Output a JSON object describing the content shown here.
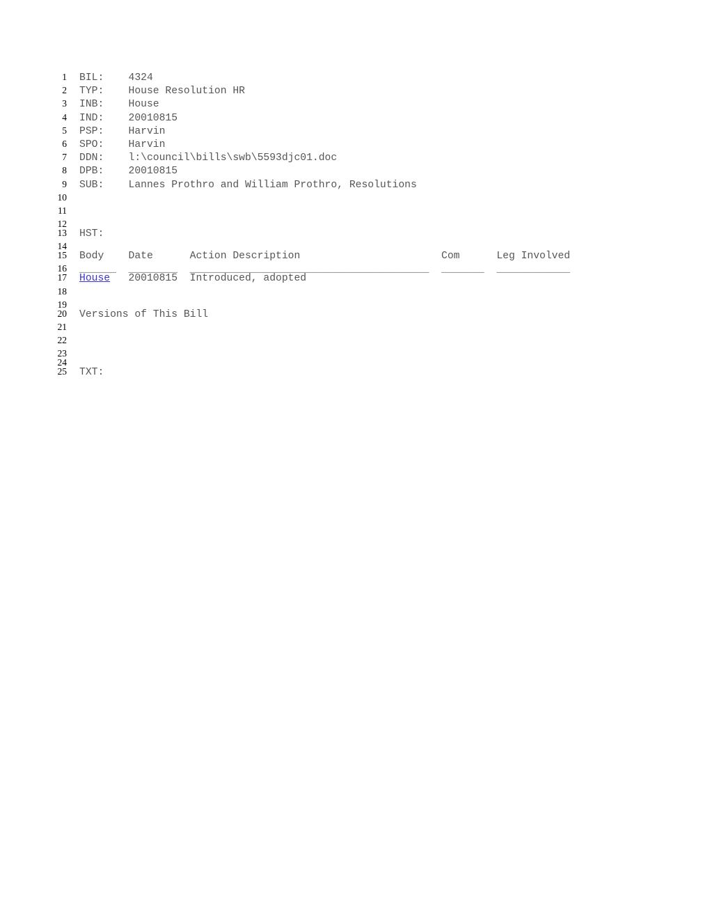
{
  "document": {
    "type": "legislative-bill-record",
    "background_color": "#ffffff",
    "text_color": "#555555",
    "link_color": "#3a35d6",
    "line_number_color": "#000000"
  },
  "fields": {
    "bil_label": "BIL:",
    "bil_value": "4324",
    "typ_label": "TYP:",
    "typ_value": "House Resolution HR",
    "inb_label": "INB:",
    "inb_value": "House",
    "ind_label": "IND:",
    "ind_value": "20010815",
    "psp_label": "PSP:",
    "psp_value": "Harvin",
    "spo_label": "SPO:",
    "spo_value": "Harvin",
    "ddn_label": "DDN:",
    "ddn_value": "l:\\council\\bills\\swb\\5593djc01.doc",
    "dpb_label": "DPB:",
    "dpb_value": "20010815",
    "sub_label": "SUB:",
    "sub_value": "Lannes Prothro and William Prothro, Resolutions",
    "hst_label": "HST:",
    "txt_label": "TXT:"
  },
  "history_table": {
    "headers": {
      "body": "Body",
      "date": "Date",
      "action_description": "Action Description",
      "com": "Com",
      "leg_involved": "Leg Involved"
    },
    "separator_row": "______  ________  _______________________________________  _______  ____________",
    "rows": [
      {
        "body": "House",
        "body_is_link": true,
        "date": "20010815",
        "action_description": "Introduced, adopted",
        "com": "",
        "leg_involved": ""
      }
    ]
  },
  "versions_heading": "Versions of This Bill",
  "lines": [
    {
      "n": "1",
      "text": "BIL:    4324",
      "tight": false
    },
    {
      "n": "2",
      "text": "TYP:    House Resolution HR",
      "tight": false
    },
    {
      "n": "3",
      "text": "INB:    House",
      "tight": false
    },
    {
      "n": "4",
      "text": "IND:    20010815",
      "tight": false
    },
    {
      "n": "5",
      "text": "PSP:    Harvin",
      "tight": false
    },
    {
      "n": "6",
      "text": "SPO:    Harvin",
      "tight": false
    },
    {
      "n": "7",
      "text": "DDN:    l:\\council\\bills\\swb\\5593djc01.doc",
      "tight": false
    },
    {
      "n": "8",
      "text": "DPB:    20010815",
      "tight": false
    },
    {
      "n": "9",
      "text": "SUB:    Lannes Prothro and William Prothro, Resolutions",
      "tight": false
    },
    {
      "n": "10",
      "text": "",
      "tight": false
    },
    {
      "n": "11",
      "text": "",
      "tight": false
    },
    {
      "n": "12",
      "text": "",
      "tight": true
    },
    {
      "n": "13",
      "text": "HST:",
      "tight": false
    },
    {
      "n": "14",
      "text": "",
      "tight": true
    },
    {
      "n": "15",
      "text": "Body    Date      Action Description                       Com      Leg Involved",
      "tight": false
    },
    {
      "n": "16",
      "text": "______  ________  _______________________________________  _______  ____________",
      "tight": true
    },
    {
      "n": "17",
      "text": "House   20010815  Introduced, adopted",
      "tight": false
    },
    {
      "n": "18",
      "text": "",
      "tight": false
    },
    {
      "n": "19",
      "text": "",
      "tight": true
    },
    {
      "n": "20",
      "text": "Versions of This Bill",
      "tight": false
    },
    {
      "n": "21",
      "text": "",
      "tight": false
    },
    {
      "n": "22",
      "text": "",
      "tight": false
    },
    {
      "n": "23",
      "text": "",
      "tight": true
    },
    {
      "n": "24",
      "text": "",
      "tight": true
    },
    {
      "n": "25",
      "text": "TXT:",
      "tight": false
    }
  ]
}
